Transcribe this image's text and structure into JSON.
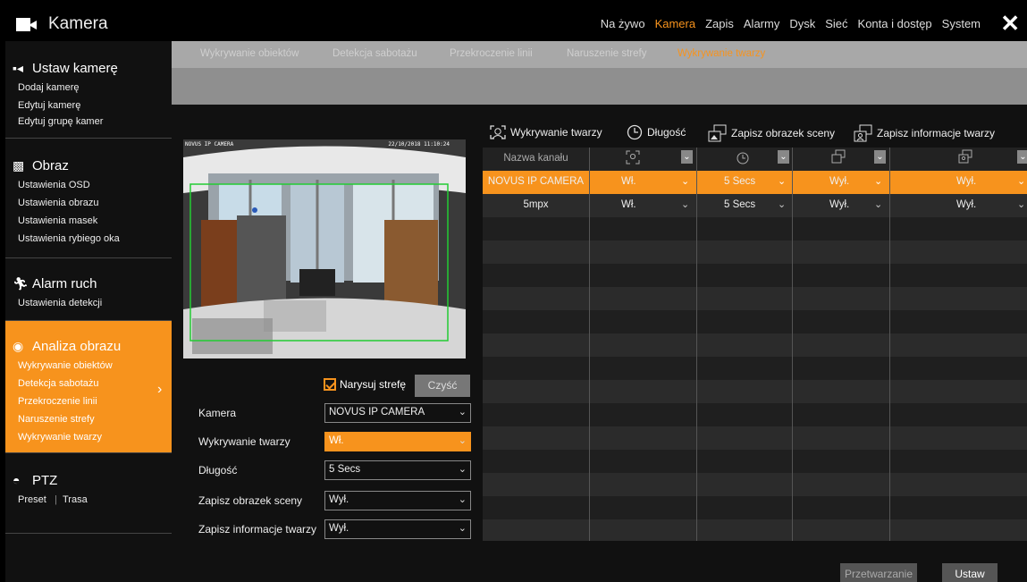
{
  "app": {
    "title": "Kamera",
    "icon": "camera-icon"
  },
  "topnav": [
    {
      "label": "Na żywo",
      "active": false
    },
    {
      "label": "Kamera",
      "active": true
    },
    {
      "label": "Zapis",
      "active": false
    },
    {
      "label": "Alarmy",
      "active": false
    },
    {
      "label": "Dysk",
      "active": false
    },
    {
      "label": "Sieć",
      "active": false
    },
    {
      "label": "Konta i dostęp",
      "active": false
    },
    {
      "label": "System",
      "active": false
    }
  ],
  "close_label": "✕",
  "sidebar": {
    "groups": [
      {
        "title": "Ustaw kamerę",
        "icon": "camera-icon",
        "items": [
          "Dodaj kamerę",
          "Edytuj kamerę",
          "Edytuj grupę kamer"
        ]
      },
      {
        "title": "Obraz",
        "icon": "image-icon",
        "items": [
          "Ustawienia OSD",
          "Ustawienia obrazu",
          "Ustawienia masek",
          "Ustawienia rybiego oka"
        ]
      },
      {
        "title": "Alarm ruch",
        "icon": "running-man-icon",
        "items": [
          "Ustawienia detekcji"
        ]
      },
      {
        "title": "Analiza obrazu",
        "icon": "analysis-icon",
        "items": [
          "Wykrywanie obiektów",
          "Detekcja sabotażu",
          "Przekroczenie linii",
          "Naruszenie strefy",
          "Wykrywanie twarzy"
        ],
        "active": true
      },
      {
        "title": "PTZ",
        "icon": "ptz-dome-icon",
        "items": [
          "Preset",
          "|",
          "Trasa"
        ]
      }
    ]
  },
  "tabs": [
    {
      "label": "Wykrywanie obiektów",
      "active": false
    },
    {
      "label": "Detekcja sabotażu",
      "active": false
    },
    {
      "label": "Przekroczenie linii",
      "active": false
    },
    {
      "label": "Naruszenie strefy",
      "active": false
    },
    {
      "label": "Wykrywanie twarzy",
      "active": true
    }
  ],
  "preview": {
    "osd_name": "NOVUS IP CAMERA",
    "osd_time": "22/10/2018 11:10:24"
  },
  "draw": {
    "checkbox_label": "Narysuj strefę",
    "checked": true,
    "clear_label": "Czyść"
  },
  "form": {
    "camera": {
      "label": "Kamera",
      "value": "NOVUS IP CAMERA"
    },
    "face_detection": {
      "label": "Wykrywanie twarzy",
      "value": "Wł."
    },
    "duration": {
      "label": "Długość",
      "value": "5 Secs"
    },
    "save_scene": {
      "label": "Zapisz obrazek sceny",
      "value": "Wył."
    },
    "save_face": {
      "label": "Zapisz informacje twarzy",
      "value": "Wył."
    }
  },
  "icon_header": {
    "face": "Wykrywanie twarzy",
    "duration": "Długość",
    "scene": "Zapisz obrazek sceny",
    "faceinfo": "Zapisz informacje twarzy"
  },
  "table": {
    "header_channel": "Nazwa kanału",
    "rows": [
      {
        "channel": "NOVUS IP CAMERA",
        "face": "Wł.",
        "duration": "5 Secs",
        "scene": "Wył.",
        "faceinfo": "Wył.",
        "selected": true
      },
      {
        "channel": "5mpx",
        "face": "Wł.",
        "duration": "5 Secs",
        "scene": "Wył.",
        "faceinfo": "Wył.",
        "selected": false
      }
    ]
  },
  "buttons": {
    "process": "Przetwarzanie",
    "apply": "Ustaw"
  },
  "colors": {
    "accent": "#f7931d",
    "tabbar": "#a8a8a8",
    "subbar": "#8f8f8f"
  }
}
